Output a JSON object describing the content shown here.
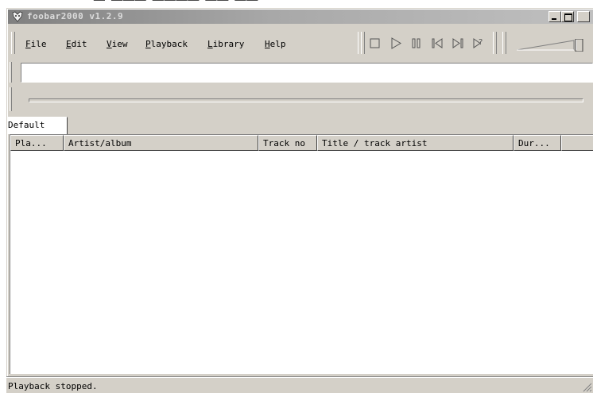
{
  "heading_fragment": "，",
  "window": {
    "title": "foobar2000 v1.2.9",
    "controls": {
      "minimize": "_",
      "maximize": "□",
      "close": "×"
    }
  },
  "menu": {
    "items": [
      {
        "label": "File",
        "accel": "F"
      },
      {
        "label": "Edit",
        "accel": "E"
      },
      {
        "label": "View",
        "accel": "V"
      },
      {
        "label": "Playback",
        "accel": "P"
      },
      {
        "label": "Library",
        "accel": "L"
      },
      {
        "label": "Help",
        "accel": "H"
      }
    ]
  },
  "toolbar": {
    "buttons": [
      "stop-icon",
      "play-icon",
      "pause-icon",
      "previous-icon",
      "next-icon",
      "random-icon"
    ],
    "volume_level": 1.0
  },
  "address_bar": {
    "value": ""
  },
  "seekbar": {
    "position": 0
  },
  "tabs": [
    {
      "label": "Default",
      "active": true
    }
  ],
  "playlist": {
    "columns": [
      "Pla...",
      "Artist/album",
      "Track no",
      "Title / track artist",
      "Dur..."
    ],
    "rows": []
  },
  "status": {
    "text": "Playback stopped."
  }
}
